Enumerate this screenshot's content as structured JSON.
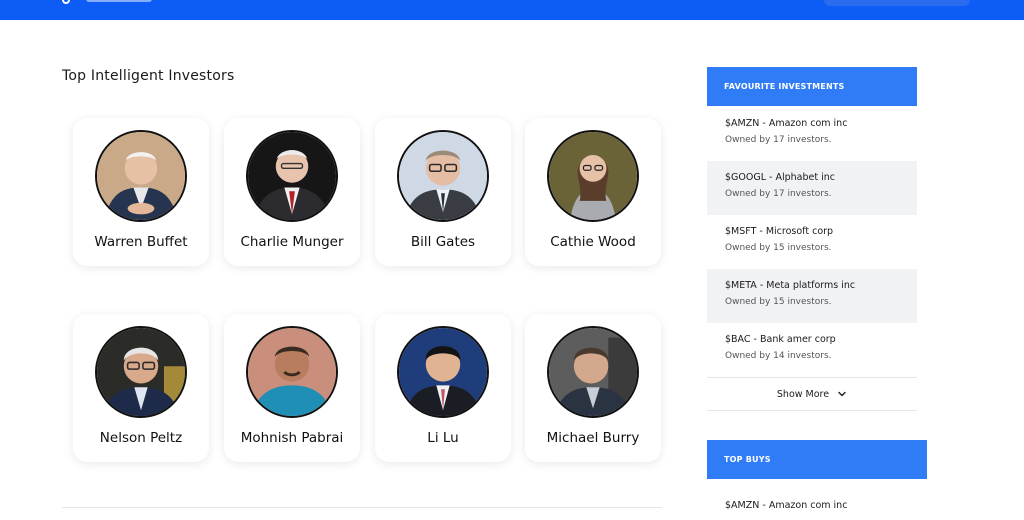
{
  "header": {
    "brand_color": "#0c5cf5",
    "logo_icon": "map-pin-icon"
  },
  "main": {
    "title": "Top Intelligent Investors",
    "investors": [
      {
        "name": "Warren Buffet"
      },
      {
        "name": "Charlie Munger"
      },
      {
        "name": "Bill Gates"
      },
      {
        "name": "Cathie Wood"
      },
      {
        "name": "Nelson Peltz"
      },
      {
        "name": "Mohnish Pabrai"
      },
      {
        "name": "Li Lu"
      },
      {
        "name": "Michael Burry"
      }
    ]
  },
  "sidebar": {
    "accent": "#2f7cf6",
    "favourites": {
      "title": "FAVOURITE INVESTMENTS",
      "items": [
        {
          "title": "$AMZN - Amazon com inc",
          "owners": "Owned by 17 investors."
        },
        {
          "title": "$GOOGL - Alphabet inc",
          "owners": "Owned by 17 investors."
        },
        {
          "title": "$MSFT - Microsoft corp",
          "owners": "Owned by 15 investors."
        },
        {
          "title": "$META - Meta platforms inc",
          "owners": "Owned by 15 investors."
        },
        {
          "title": "$BAC - Bank amer corp",
          "owners": "Owned by 14 investors."
        }
      ],
      "show_more": "Show More",
      "show_more_icon": "chevron-down-icon"
    },
    "top_buys": {
      "title": "TOP BUYS",
      "items": [
        {
          "title": "$AMZN - Amazon com inc"
        }
      ]
    }
  }
}
